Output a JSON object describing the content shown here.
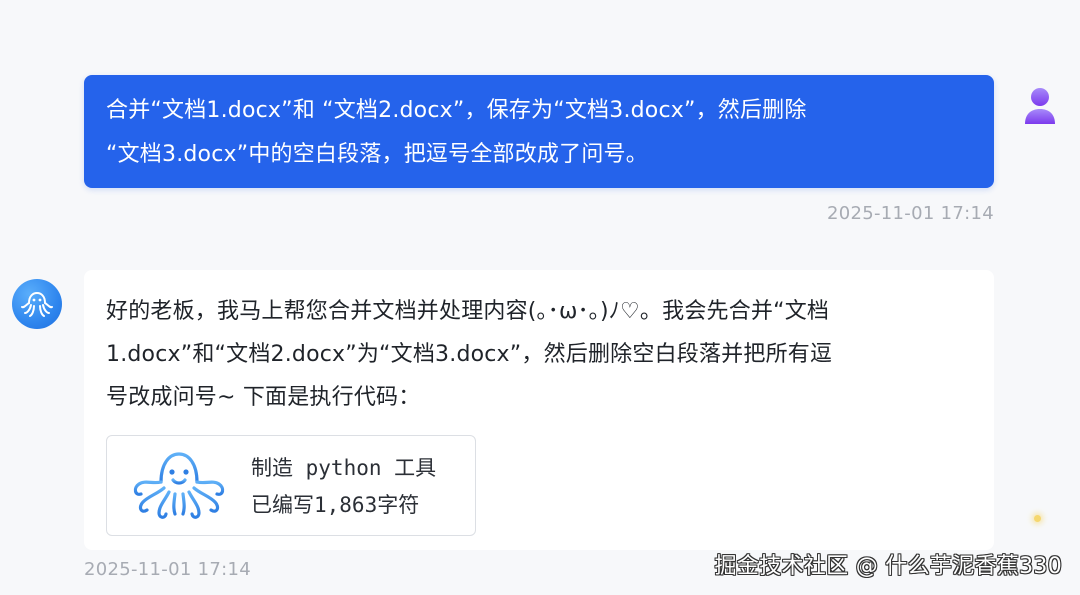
{
  "user_message": {
    "lines": [
      "合并“文档1.docx”和 “文档2.docx”，保存为“文档3.docx”，然后删除",
      "“文档3.docx”中的空白段落，把逗号全部改成了问号。"
    ],
    "timestamp": "2025-11-01 17:14",
    "avatar_icon": "user-avatar-icon",
    "bubble_color": "#2563eb"
  },
  "bot_message": {
    "lines": [
      "好的老板，我马上帮您合并文档并处理内容(｡･ω･｡)ﾉ♡。我会先合并“文档",
      "1.docx”和“文档2.docx”为“文档3.docx”，然后删除空白段落并把所有逗",
      "号改成问号~ 下面是执行代码："
    ],
    "tool": {
      "title": "制造 python 工具",
      "subtitle": "已编写1,863字符",
      "icon": "octopus-icon"
    },
    "timestamp": "2025-11-01 17:14",
    "avatar_icon": "octopus-avatar-icon"
  },
  "watermark": "掘金技术社区 @ 什么芋泥香蕉330"
}
